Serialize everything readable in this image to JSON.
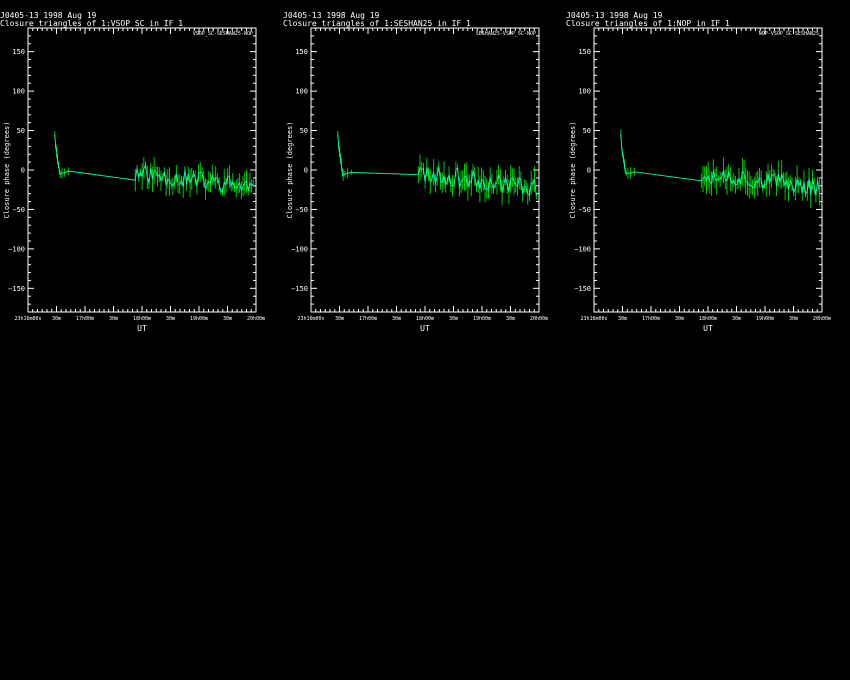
{
  "panels": [
    {
      "header_line1": "J0405-13  1998 Aug 19",
      "header_line2": "Closure triangles of 1:VSOP_SC in IF 1",
      "triangle_label": "VSOP_SC-SESHAN25-NOP",
      "chart_data": {
        "type": "line",
        "xlabel": "UT",
        "ylabel": "Closure phase  (degrees)",
        "ylim": [
          -180,
          180
        ],
        "yticks": [
          -150,
          -100,
          -50,
          0,
          50,
          100,
          150
        ],
        "xlim": [
          16.75,
          19.3
        ],
        "xticks": [
          "23h16m00s",
          "30m",
          "17h00m",
          "30m",
          "18h00m",
          "30m",
          "19h00m",
          "30m",
          "20h00m"
        ],
        "color": "#00ffb0",
        "seed": 11
      }
    },
    {
      "header_line1": "J0405-13  1998 Aug 19",
      "header_line2": "Closure triangles of 1:SESHAN25 in IF 1",
      "triangle_label": "SESHAN25-VSOP_SC-NOP",
      "chart_data": {
        "type": "line",
        "xlabel": "UT",
        "ylabel": "Closure phase  (degrees)",
        "ylim": [
          -180,
          180
        ],
        "yticks": [
          -150,
          -100,
          -50,
          0,
          50,
          100,
          150
        ],
        "xlim": [
          16.75,
          19.3
        ],
        "xticks": [
          "23h16m00s",
          "30m",
          "17h00m",
          "30m",
          "18h00m",
          "30m",
          "19h00m",
          "30m",
          "20h00m"
        ],
        "color": "#00ffb0",
        "seed": 23
      }
    },
    {
      "header_line1": "J0405-13  1998 Aug 19",
      "header_line2": "Closure triangles of 1:NOP in IF 1",
      "triangle_label": "NOP-VSOP_SC-SESHAN25",
      "chart_data": {
        "type": "line",
        "xlabel": "UT",
        "ylabel": "Closure phase  (degrees)",
        "ylim": [
          -180,
          180
        ],
        "yticks": [
          -150,
          -100,
          -50,
          0,
          50,
          100,
          150
        ],
        "xlim": [
          16.75,
          19.3
        ],
        "xticks": [
          "23h16m00s",
          "30m",
          "17h00m",
          "30m",
          "18h00m",
          "30m",
          "19h00m",
          "30m",
          "20h00m"
        ],
        "color": "#00ffb0",
        "seed": 37
      }
    }
  ]
}
